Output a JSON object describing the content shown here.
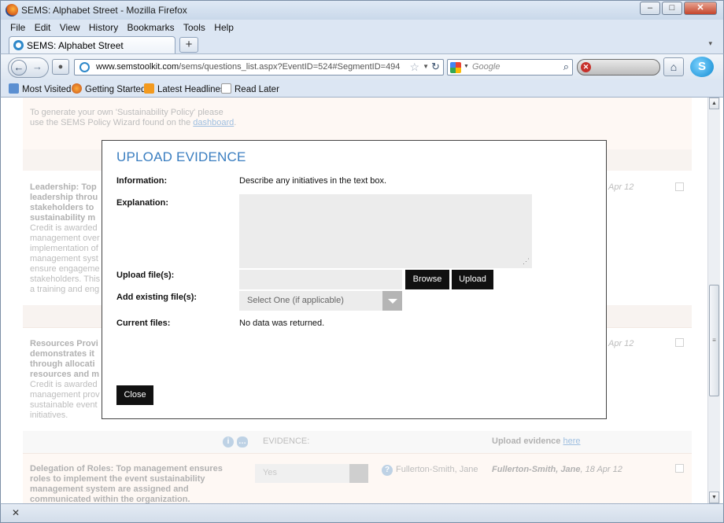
{
  "window": {
    "title": "SEMS: Alphabet Street - Mozilla Firefox",
    "min": "‒",
    "max": "□",
    "close": "✕"
  },
  "menu": [
    "File",
    "Edit",
    "View",
    "History",
    "Bookmarks",
    "Tools",
    "Help"
  ],
  "tab": {
    "label": "SEMS: Alphabet Street",
    "new_tab": "+",
    "list": "▾"
  },
  "nav": {
    "url_domain": "www.semstoolkit.com",
    "url_path": "/sems/questions_list.aspx?EventID=524#SegmentID=494",
    "search_placeholder": "Google"
  },
  "bookmarks": [
    "Most Visited",
    "Getting Started",
    "Latest Headlines",
    "Read Later"
  ],
  "background": {
    "policy_line1": "To generate your own 'Sustainability Policy' please",
    "policy_line2": "use the SEMS Policy Wizard found on the",
    "policy_link": "dashboard",
    "leadership_bold": [
      "Leadership: Top",
      "leadership throu",
      "stakeholders to",
      "sustainability m"
    ],
    "leadership_text": [
      "Credit is awarded",
      "management over",
      "implementation of",
      "management syst",
      "ensure engageme",
      "stakeholders. This",
      "a training and eng"
    ],
    "resources_bold": [
      "Resources Provi",
      "demonstrates it",
      "through allocati",
      "resources and m"
    ],
    "resources_text": [
      "Credit is awarded",
      "management prov",
      "sustainable event",
      "initiatives."
    ],
    "date1": "Apr 12",
    "date2": "Apr 12",
    "evidence_label": "EVIDENCE:",
    "upload_evidence": "Upload evidence",
    "here_link": "here",
    "delegation_bold": [
      "Delegation of Roles: Top management ensures",
      "roles to implement the event sustainability",
      "management system are assigned and",
      "communicated within the organization."
    ],
    "yes_select": "Yes",
    "assignee": "Fullerton-Smith, Jane",
    "assignee_bold": "Fullerton-Smith, Jane",
    "assignee_date": ", 18 Apr 12"
  },
  "modal": {
    "title": "UPLOAD EVIDENCE",
    "information_label": "Information:",
    "information_value": "Describe any initiatives in the text box.",
    "explanation_label": "Explanation:",
    "upload_label": "Upload file(s):",
    "browse_button": "Browse",
    "upload_button": "Upload",
    "existing_label": "Add existing file(s):",
    "existing_select": "Select One (if applicable)",
    "current_label": "Current files:",
    "current_value": "No data was returned.",
    "close_button": "Close"
  },
  "status": {
    "close_icon": "✕"
  }
}
